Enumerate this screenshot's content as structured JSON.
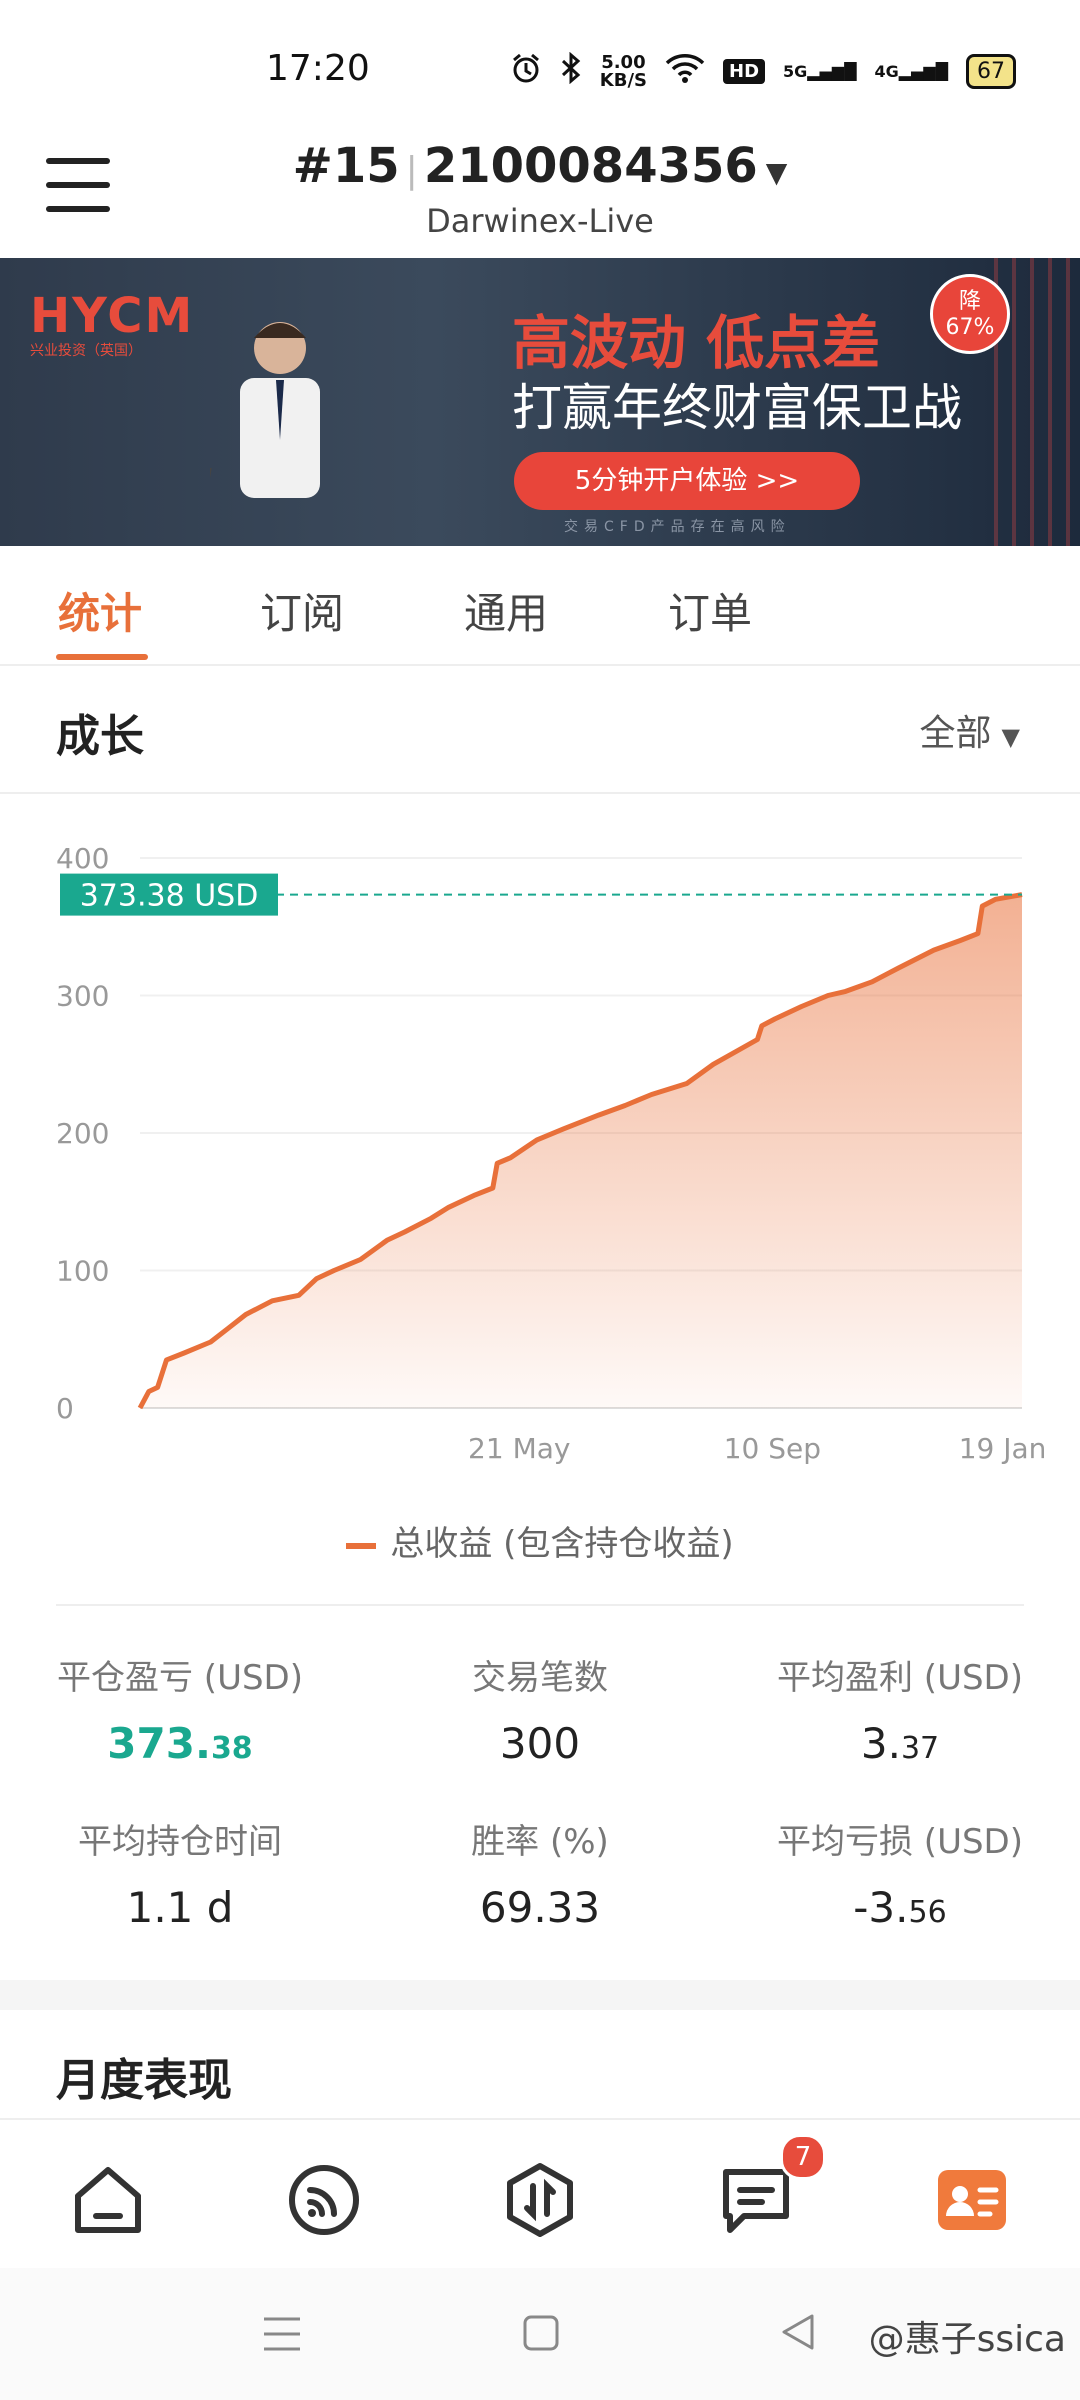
{
  "status_bar": {
    "time": "17:20",
    "network_speed": "5.00",
    "network_speed_unit": "KB/S",
    "hd_label": "HD",
    "signal1": "5G",
    "signal2": "4G",
    "battery": "67"
  },
  "header": {
    "account_number": "#15",
    "account_id": "2100084356",
    "account_type": "Darwinex-Live"
  },
  "banner": {
    "brand": "HYCM",
    "brand_sub": "兴业投资（英国）",
    "headline": "高波动 低点差",
    "subline": "打赢年终财富保卫战",
    "badge": "降\n67%",
    "cta": "5分钟开户体验 >>",
    "note": "交易CFD产品存在高风险"
  },
  "tabs": [
    "统计",
    "订阅",
    "通用",
    "订单"
  ],
  "section": {
    "title": "成长",
    "filter": "全部"
  },
  "chart_data": {
    "type": "area",
    "yticks": [
      "0",
      "100",
      "200",
      "300",
      "400"
    ],
    "ylim": [
      0,
      400
    ],
    "xticks": [
      "21 May",
      "10 Sep",
      "19 Jan"
    ],
    "current_value_label": "373.38 USD",
    "current_value": 373.38,
    "legend": "总收益 (包含持仓收益)",
    "color": "#e8703a",
    "x": [
      0,
      0.01,
      0.02,
      0.03,
      0.05,
      0.08,
      0.1,
      0.12,
      0.15,
      0.18,
      0.2,
      0.22,
      0.25,
      0.28,
      0.3,
      0.33,
      0.35,
      0.38,
      0.4,
      0.405,
      0.42,
      0.45,
      0.48,
      0.52,
      0.55,
      0.58,
      0.6,
      0.62,
      0.65,
      0.7,
      0.705,
      0.72,
      0.75,
      0.78,
      0.8,
      0.83,
      0.86,
      0.9,
      0.93,
      0.95,
      0.955,
      0.97,
      1.0
    ],
    "values": [
      0,
      12,
      15,
      35,
      40,
      48,
      58,
      68,
      78,
      82,
      94,
      100,
      108,
      122,
      128,
      138,
      146,
      155,
      160,
      178,
      182,
      195,
      203,
      213,
      220,
      228,
      232,
      236,
      250,
      268,
      278,
      283,
      292,
      300,
      303,
      310,
      320,
      333,
      340,
      345,
      365,
      370,
      373.38
    ]
  },
  "stats": [
    {
      "label": "平仓盈亏 (USD)",
      "value_main": "373.",
      "value_small": "38"
    },
    {
      "label": "交易笔数",
      "value_main": "300",
      "value_small": ""
    },
    {
      "label": "平均盈利 (USD)",
      "value_main": "3.",
      "value_small": "37"
    },
    {
      "label": "平均持仓时间",
      "value_main": "1.1 d",
      "value_small": ""
    },
    {
      "label": "胜率 (%)",
      "value_main": "69.33",
      "value_small": ""
    },
    {
      "label": "平均亏损 (USD)",
      "value_main": "-3.",
      "value_small": "56"
    }
  ],
  "monthly_title": "月度表现",
  "bottom_nav": {
    "messages_badge": "7"
  },
  "watermark": "@惠子ssica"
}
